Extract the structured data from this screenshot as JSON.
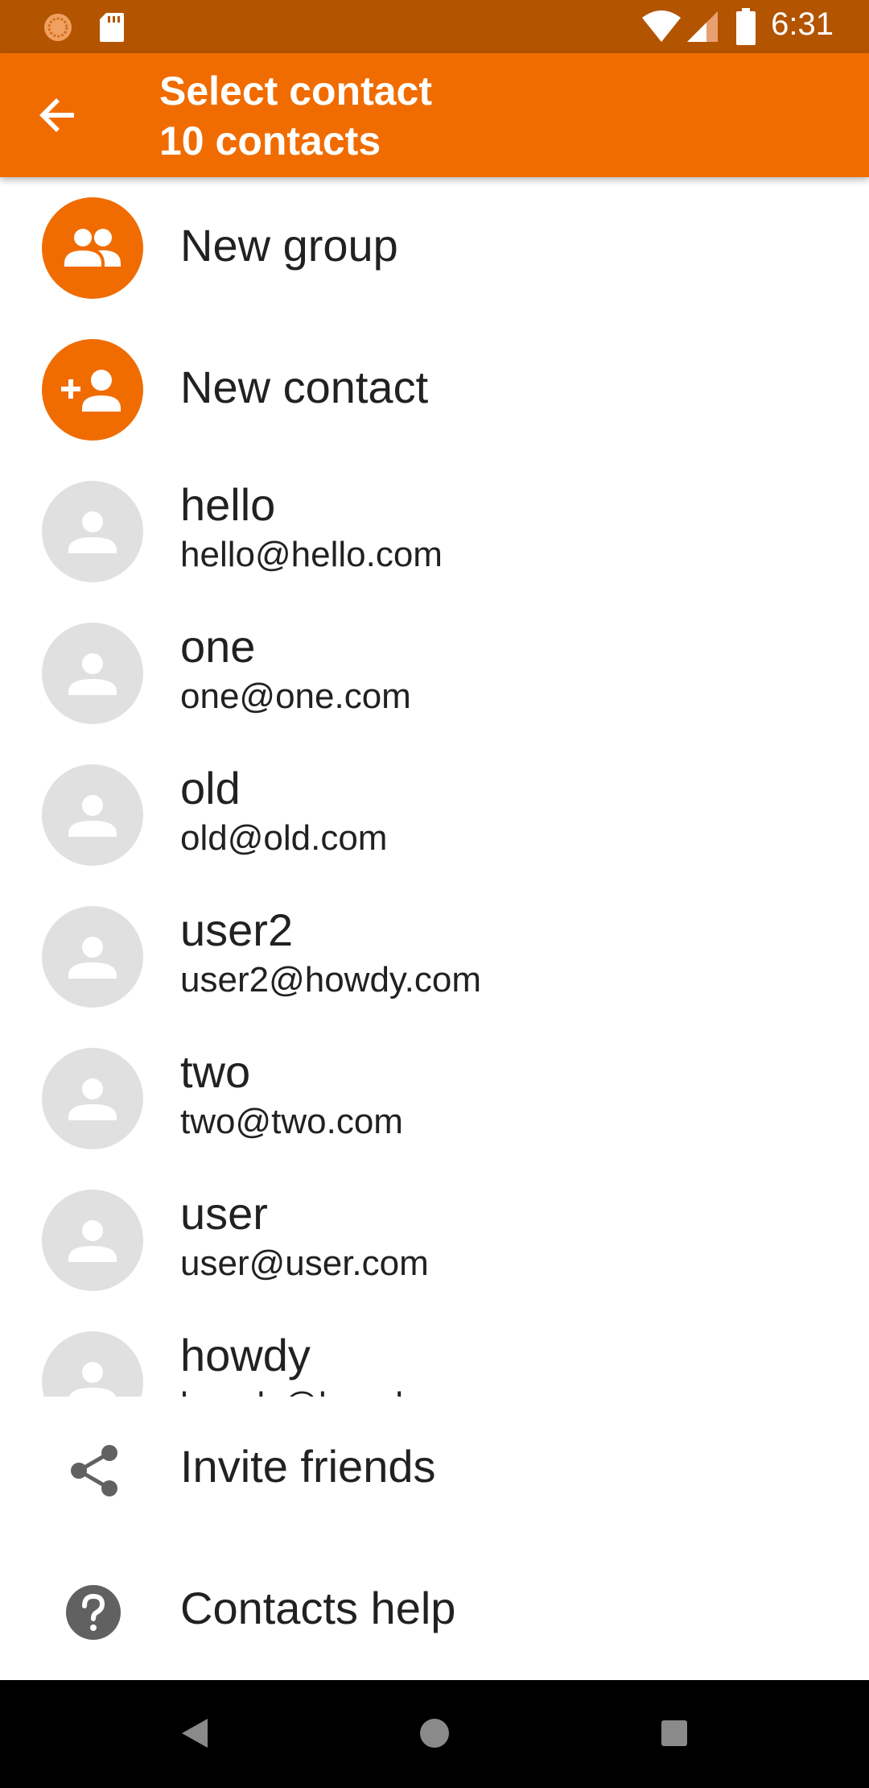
{
  "status_bar": {
    "time": "6:31",
    "icons": [
      "app-notification-icon",
      "sd-card-icon",
      "wifi-icon",
      "signal-icon",
      "battery-icon"
    ]
  },
  "app_bar": {
    "title": "Select contact",
    "subtitle": "10 contacts",
    "back_icon": "arrow-back-icon",
    "color": "#f06c00"
  },
  "list": {
    "new_group": "New group",
    "new_contact": "New contact",
    "contacts": [
      {
        "name": "hello",
        "email": "hello@hello.com"
      },
      {
        "name": "one",
        "email": "one@one.com"
      },
      {
        "name": "old",
        "email": "old@old.com"
      },
      {
        "name": "user2",
        "email": "user2@howdy.com"
      },
      {
        "name": "two",
        "email": "two@two.com"
      },
      {
        "name": "user",
        "email": "user@user.com"
      },
      {
        "name": "howdy",
        "email": "howdy@howdy.com"
      }
    ]
  },
  "actions": {
    "invite": "Invite friends",
    "help": "Contacts help"
  },
  "colors": {
    "status_bar": "#b35400",
    "accent": "#f06c00",
    "avatar_placeholder": "#e0e0e0"
  }
}
